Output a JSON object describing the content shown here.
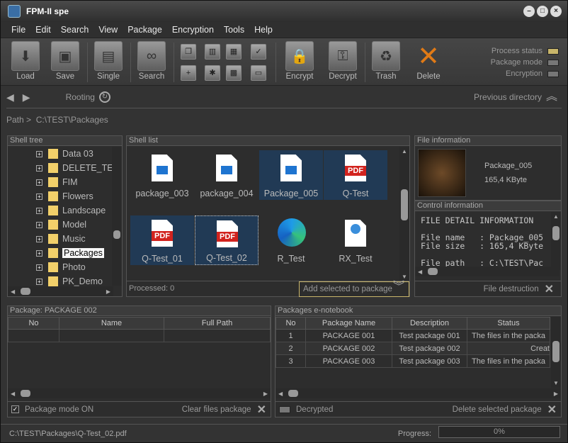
{
  "window": {
    "title": "FPM-II spe",
    "controls": [
      "–",
      "□",
      "×"
    ]
  },
  "menu": [
    "File",
    "Edit",
    "Search",
    "View",
    "Package",
    "Encryption",
    "Tools",
    "Help"
  ],
  "toolbar": {
    "load": "Load",
    "save": "Save",
    "single": "Single",
    "search": "Search",
    "encrypt": "Encrypt",
    "decrypt": "Decrypt",
    "trash": "Trash",
    "delete": "Delete"
  },
  "status": {
    "process_status": "Process status",
    "process_status_on": true,
    "package_mode": "Package mode",
    "package_mode_on": false,
    "encryption": "Encryption",
    "encryption_on": false
  },
  "nav": {
    "rooting": "Rooting",
    "previous_directory": "Previous directory"
  },
  "path": {
    "label": "Path >",
    "value": "C:\\TEST\\Packages"
  },
  "shell_tree": {
    "title": "Shell tree",
    "items": [
      "Data 03",
      "DELETE_TES",
      "FIM",
      "Flowers",
      "Landscape",
      "Model",
      "Music",
      "Packages",
      "Photo",
      "PK_Demo"
    ],
    "selected_index": 7
  },
  "shell_list": {
    "title": "Shell list",
    "files": [
      {
        "name": "package_003",
        "kind": "image",
        "selected": false,
        "focus": false
      },
      {
        "name": "package_004",
        "kind": "image",
        "selected": false,
        "focus": false
      },
      {
        "name": "Package_005",
        "kind": "image",
        "selected": true,
        "focus": false
      },
      {
        "name": "Q-Test",
        "kind": "pdf",
        "selected": true,
        "focus": false
      },
      {
        "name": "Q-Test_01",
        "kind": "pdf",
        "selected": true,
        "focus": false
      },
      {
        "name": "Q-Test_02",
        "kind": "pdf",
        "selected": true,
        "focus": true
      },
      {
        "name": "R_Test",
        "kind": "edge",
        "selected": false,
        "focus": false
      },
      {
        "name": "RX_Test",
        "kind": "web",
        "selected": false,
        "focus": false
      }
    ],
    "pdf_badge": "PDF",
    "processed": "Processed: 0",
    "add_selected": "Add selected to package"
  },
  "file_info": {
    "title": "File information",
    "name": "Package_005",
    "size": "165,4 KByte"
  },
  "control_info": {
    "title": "Control information",
    "lines": [
      "FILE DETAIL INFORMATION",
      "",
      "File name   : Package_005",
      "File size   : 165,4 KByte",
      "",
      "File path   : C:\\TEST\\Pac"
    ],
    "file_destruction": "File destruction"
  },
  "package_panel": {
    "title": "Package: PACKAGE 002",
    "columns": [
      "No",
      "Name",
      "Full Path"
    ],
    "package_mode_label": "Package mode ON",
    "package_mode_checked": true,
    "clear_files": "Clear files package"
  },
  "notebook_panel": {
    "title": "Packages e-notebook",
    "columns": [
      "No",
      "Package Name",
      "Description",
      "Status"
    ],
    "rows": [
      [
        "1",
        "PACKAGE 001",
        "Test package 001",
        "The files in the packa"
      ],
      [
        "2",
        "PACKAGE 002",
        "Test package 002",
        "Creat"
      ],
      [
        "3",
        "PACKAGE 003",
        "Test package 003",
        "The files in the packa"
      ]
    ],
    "decrypted": "Decrypted",
    "delete_selected": "Delete selected  package"
  },
  "statusbar": {
    "path": "C:\\TEST\\Packages\\Q-Test_02.pdf",
    "progress_label": "Progress:",
    "progress_text": "0%",
    "progress_value": 0
  },
  "colors": {
    "accent": "#c8b56a",
    "selection": "#213a55"
  }
}
